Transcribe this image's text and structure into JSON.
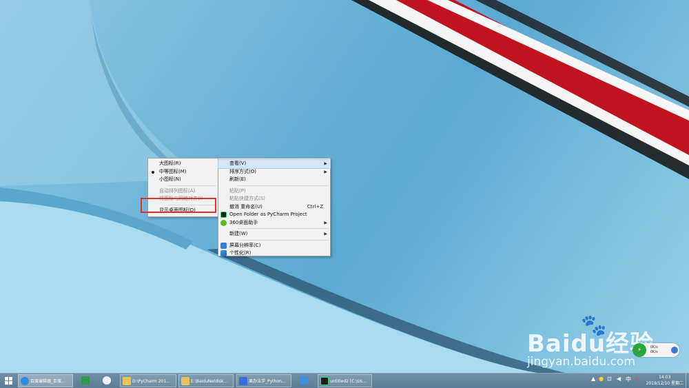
{
  "context_menu": {
    "items": [
      {
        "label": "查看(V)",
        "submenu": true,
        "highlighted": true
      },
      {
        "label": "排序方式(O)",
        "submenu": true
      },
      {
        "label": "刷新(E)"
      },
      {
        "label": "粘贴(P)",
        "disabled": true
      },
      {
        "label": "粘贴快捷方式(S)",
        "disabled": true
      },
      {
        "label": "撤消 重命名(U)",
        "shortcut": "Ctrl+Z"
      },
      {
        "label": "Open Folder as PyCharm Project",
        "icon": "pycharm-icon"
      },
      {
        "label": "360桌面助手",
        "submenu": true,
        "icon": "360-icon"
      },
      {
        "label": "新建(W)",
        "submenu": true
      },
      {
        "label": "屏幕分辨率(C)",
        "icon": "display-icon"
      },
      {
        "label": "个性化(R)",
        "icon": "personalize-icon"
      }
    ]
  },
  "view_submenu": {
    "items": [
      {
        "label": "大图标(R)"
      },
      {
        "label": "中等图标(M)",
        "selected": true
      },
      {
        "label": "小图标(N)"
      },
      {
        "label": "自动排列图标(A)",
        "disabled": true
      },
      {
        "label": "将图标与网格对齐(I)",
        "disabled": true
      },
      {
        "label": "显示桌面图标(D)"
      }
    ]
  },
  "watermark": {
    "brand": "Baidu经验",
    "url": "jingyan.baidu.com"
  },
  "net_widget": {
    "up": "0K/s",
    "down": "0K/s"
  },
  "taskbar": {
    "buttons": [
      {
        "label": "百度编辑器_百度...",
        "icon": "browser-icon"
      },
      {
        "label": "",
        "icon": "spreadsheet-icon"
      },
      {
        "label": "",
        "icon": "baidu-netdisk-icon"
      },
      {
        "label": "D:\\PyCharm 201...",
        "icon": "folder-icon"
      },
      {
        "label": "E:\\BaiduNetdisk...",
        "icon": "folder-icon"
      },
      {
        "label": "果办法学_Python...",
        "icon": "vs-icon"
      },
      {
        "label": "",
        "icon": "app-icon"
      },
      {
        "label": "untitled2 [C:\\Us...",
        "icon": "pycharm-icon"
      }
    ],
    "clock": {
      "time": "14:03",
      "date": "2019/12/10 星期二"
    }
  },
  "colors": {
    "highlight_box": "#e0302c",
    "menu_bg": "#f2f2f2",
    "taskbar": "#6682a0"
  }
}
